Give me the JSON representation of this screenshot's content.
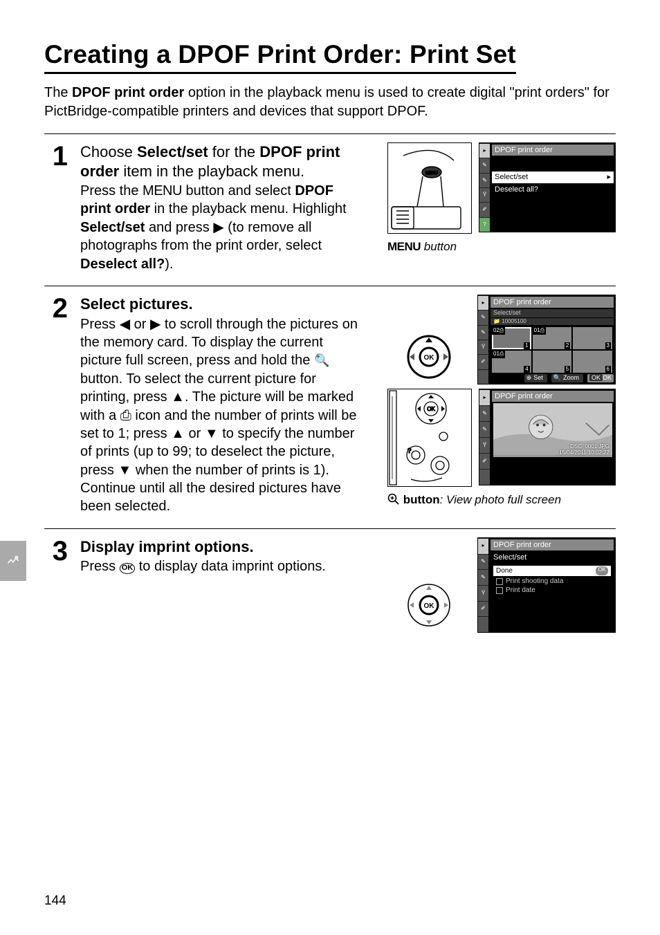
{
  "page_number": "144",
  "title": "Creating a DPOF Print Order: Print Set",
  "intro_parts": {
    "p1": "The ",
    "b1": "DPOF print order",
    "p2": " option in the playback menu is used to create digital \"print orders\" for PictBridge-compatible printers and devices that support DPOF."
  },
  "steps": {
    "s1": {
      "num": "1",
      "head_pre": "Choose ",
      "head_b1": "Select/set",
      "head_mid": " for the ",
      "head_b2": "DPOF print order",
      "head_suf": " item in the playback menu.",
      "text_p1": "Press the ",
      "text_menu": "MENU",
      "text_p2": " button and select ",
      "text_b1": "DPOF print order",
      "text_p3": " in the playback menu.  Highlight ",
      "text_b2": "Select/set",
      "text_p4": " and press ",
      "glyph_right": "▶",
      "text_p5": " (to remove all photographs from the print order, select ",
      "text_b3": "Deselect all?",
      "text_p6": ").",
      "caption_menu": "MENU",
      "caption_suf": " button"
    },
    "s2": {
      "num": "2",
      "head": "Select pictures.",
      "text_p1": "Press ",
      "glyph_left": "◀",
      "text_or": " or ",
      "glyph_right": "▶",
      "text_p2": " to scroll through the pictures on the memory card.  To display the current picture full screen, press and hold the ",
      "glyph_magnify": "⊕",
      "text_p3": " button.  To select the current picture for printing, press ",
      "glyph_up": "▲",
      "text_p4": ".  The picture will be marked with a ",
      "glyph_printer": "🖶",
      "text_p5": " icon and the number of prints will be set to 1; press ",
      "glyph_up2": "▲",
      "text_or2": " or ",
      "glyph_down": "▼",
      "text_p6": " to specify the number of prints (up to 99; to deselect the picture, press ",
      "glyph_down2": "▼",
      "text_p7": " when the number of prints is 1).  Continue until all the desired pictures have been selected.",
      "caption_b": "button",
      "caption_i": ": View photo full screen"
    },
    "s3": {
      "num": "3",
      "head": "Display imprint options.",
      "text_p1": "Press ",
      "glyph_ok": "OK",
      "text_p2": " to display data imprint options."
    }
  },
  "lcd1": {
    "header": "DPOF print order",
    "row_sel": "Select/set",
    "row_arrow": "▸",
    "row2": "Deselect all?"
  },
  "lcd2a": {
    "header": "DPOF print order",
    "sub1": "Select/set",
    "sub2": "10005100",
    "tags": {
      "t1": "02",
      "t2": "01",
      "t3": "01"
    },
    "corners": {
      "c1": "1",
      "c2": "2",
      "c3": "3",
      "c4": "4",
      "c5": "5",
      "c6": "6"
    },
    "footer": {
      "f1": "Set",
      "f2": "Zoom",
      "f3": "OK"
    }
  },
  "lcd2b": {
    "header": "DPOF print order",
    "meta1": "DSC_0001.JPG",
    "meta2": "15/04/2011 10:02:27"
  },
  "lcd3": {
    "header": "DPOF print order",
    "sub": "Select/set",
    "done": "Done",
    "done_ok": "OK",
    "opt1": "Print shooting data",
    "opt2": "Print date"
  }
}
